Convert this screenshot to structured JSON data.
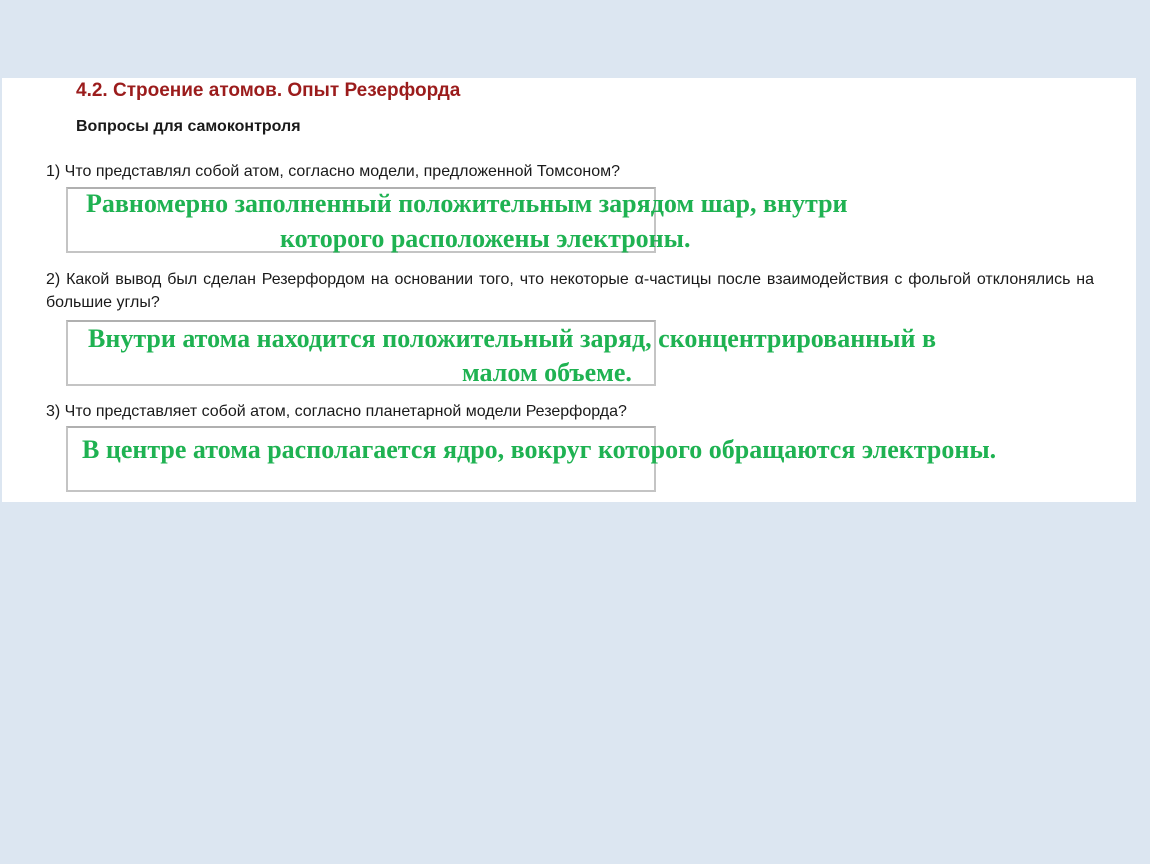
{
  "heading": {
    "title": "4.2. Строение атомов. Опыт Резерфорда",
    "subtitle": "Вопросы для самоконтроля"
  },
  "questions": [
    {
      "text": "1) Что представлял собой атом, согласно модели, предложенной Томсоном?",
      "answer_line1": "Равномерно заполненный положительным зарядом шар, внутри",
      "answer_line2": "которого расположены электроны."
    },
    {
      "text": "2) Какой вывод был сделан Резерфордом на основании того, что некоторые α-частицы после взаимодействия с фольгой отклонялись на большие углы?",
      "answer_line1": "Внутри атома находится положительный заряд, сконцентрированный в",
      "answer_line2": "малом объеме."
    },
    {
      "text": "3) Что представляет собой атом, согласно планетарной модели Резерфорда?",
      "answer_line1": "В центре атома располагается ядро, вокруг которого обращаются электроны.",
      "answer_line2": ""
    }
  ],
  "colors": {
    "background": "#dce6f1",
    "title": "#9b1c1c",
    "answer": "#1fb252"
  }
}
